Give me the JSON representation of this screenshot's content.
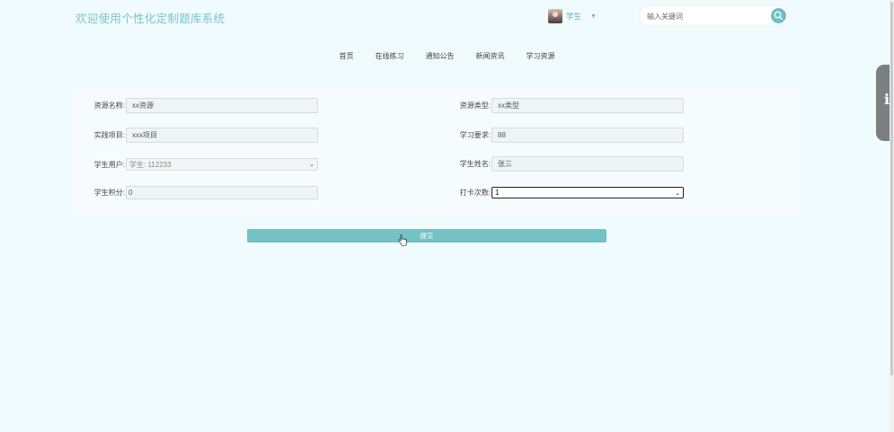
{
  "header": {
    "site_title": "欢迎使用个性化定制题库系统",
    "user_role": "学生",
    "search_placeholder": "输入关键词"
  },
  "nav": {
    "items": [
      "首页",
      "在线练习",
      "通知公告",
      "新闻资讯",
      "学习资源"
    ]
  },
  "form": {
    "resource_name": {
      "label": "资源名称:",
      "value": "xx资源"
    },
    "resource_type": {
      "label": "资源类型:",
      "value": "xx类型"
    },
    "practice_item": {
      "label": "实践项目:",
      "value": "xxx项目"
    },
    "study_duration": {
      "label": "学习要求:",
      "value": "88"
    },
    "student_user": {
      "label": "学生用户:",
      "value": "学生: 112233"
    },
    "student_name": {
      "label": "学生姓名:",
      "value": "张三"
    },
    "student_points": {
      "label": "学生积分:",
      "value": "0"
    },
    "checkin_count": {
      "label": "打卡次数:",
      "value": "1"
    },
    "submit_label": "提交"
  },
  "colors": {
    "accent": "#72c2c6",
    "page_bg": "#f0fbfe"
  }
}
